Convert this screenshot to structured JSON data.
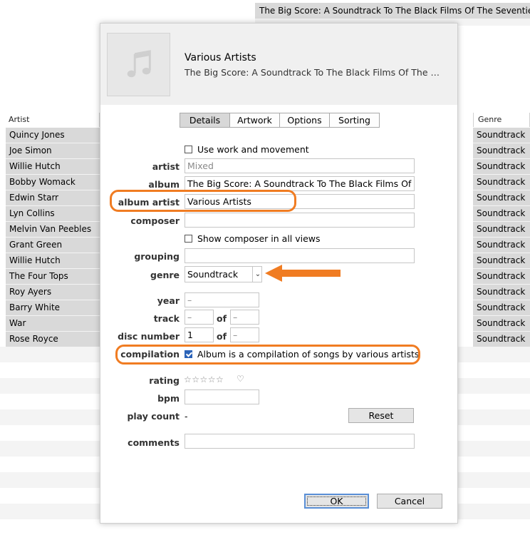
{
  "background": {
    "top_item": "The Big Score: A Soundtrack To The Black Films Of The Seventies",
    "columns": {
      "artist": "Artist",
      "genre": "Genre"
    },
    "artists": [
      "Quincy Jones",
      "Joe Simon",
      "Willie Hutch",
      "Bobby Womack",
      "Edwin Starr",
      "Lyn Collins",
      "Melvin Van Peebles",
      "Grant Green",
      "Willie Hutch",
      "The Four Tops",
      "Roy Ayers",
      "Barry White",
      "War",
      "Rose Royce"
    ],
    "genres": [
      "Soundtrack",
      "Soundtrack",
      "Soundtrack",
      "Soundtrack",
      "Soundtrack",
      "Soundtrack",
      "Soundtrack",
      "Soundtrack",
      "Soundtrack",
      "Soundtrack",
      "Soundtrack",
      "Soundtrack",
      "Soundtrack",
      "Soundtrack"
    ]
  },
  "dialog": {
    "header": {
      "title": "Various Artists",
      "subtitle": "The Big Score: A Soundtrack To The Black Films Of The Seve…",
      "artwork_icon": "music-note-icon"
    },
    "tabs": [
      "Details",
      "Artwork",
      "Options",
      "Sorting"
    ],
    "active_tab": "Details",
    "use_work_label": "Use work and movement",
    "labels": {
      "artist": "artist",
      "album": "album",
      "album_artist": "album artist",
      "composer": "composer",
      "grouping": "grouping",
      "genre": "genre",
      "year": "year",
      "track": "track",
      "disc_number": "disc number",
      "of": "of",
      "compilation": "compilation",
      "rating": "rating",
      "bpm": "bpm",
      "play_count": "play count",
      "comments": "comments"
    },
    "values": {
      "artist_placeholder": "Mixed",
      "album": "The Big Score: A Soundtrack To The Black Films Of The",
      "album_artist": "Various Artists",
      "composer": "",
      "grouping": "",
      "genre": "Soundtrack",
      "year_placeholder": "–",
      "track_placeholder": "–",
      "track_of_placeholder": "–",
      "disc_number": "1",
      "disc_of_placeholder": "–",
      "bpm": "",
      "play_count": "-",
      "comments": ""
    },
    "show_composer_label": "Show composer in all views",
    "compilation_label": "Album is a compilation of songs by various artists",
    "compilation_checked": true,
    "rating_stars": "☆☆☆☆☆",
    "love_icon": "heart-icon",
    "buttons": {
      "reset": "Reset",
      "ok": "OK",
      "cancel": "Cancel"
    }
  },
  "annotation_color": "#f07c22"
}
